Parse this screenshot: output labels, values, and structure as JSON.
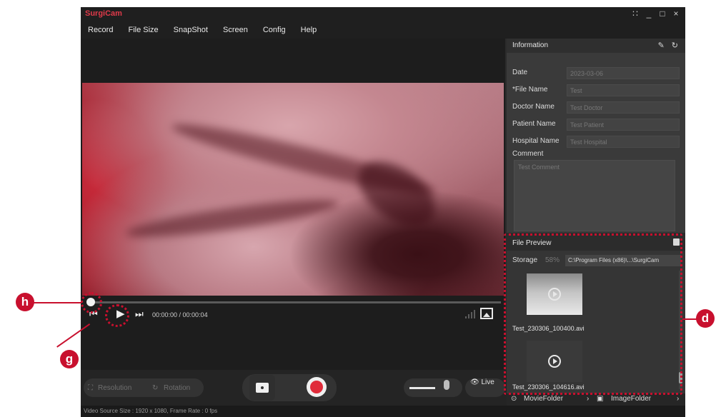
{
  "window": {
    "title": "SurgiCam",
    "controls": {
      "grid": "∷",
      "minimize": "_",
      "maximize": "□",
      "close": "×"
    }
  },
  "menu": [
    "Record",
    "File Size",
    "SnapShot",
    "Screen",
    "Config",
    "Help"
  ],
  "player": {
    "time": "00:00:00  /  00:00:04",
    "icons": [
      "skip-back-icon",
      "play-icon",
      "skip-forward-icon",
      "signal-icon",
      "picture-in-picture-icon"
    ],
    "seek_position": 0
  },
  "information": {
    "title": "Information",
    "fields": [
      {
        "label": "Date",
        "value": "2023-03-06"
      },
      {
        "label": "*File Name",
        "value": "Test"
      },
      {
        "label": "Doctor Name",
        "value": "Test Doctor"
      },
      {
        "label": "Patient Name",
        "value": "Test Patient"
      },
      {
        "label": "Hospital Name",
        "value": "Test Hospital"
      }
    ],
    "comment_label": "Comment",
    "comment_value": "Test Comment"
  },
  "file_preview": {
    "title": "File Preview",
    "storage_label": "Storage",
    "storage_percent": "58%",
    "storage_path": "C:\\Program Files (x86)\\...\\SurgiCam",
    "files": [
      "Test_230306_100400.avi",
      "Test_230306_104616.avi"
    ]
  },
  "folders": {
    "movie": "MovieFolder",
    "image": "ImageFolder"
  },
  "toolbar": {
    "resolution": "Resolution",
    "rotation": "Rotation",
    "live": "Live"
  },
  "status": {
    "text": "Video Source Size : 1920 x 1080, Frame Rate : 0 fps"
  },
  "callouts": {
    "h": "h",
    "g": "g",
    "d": "d"
  },
  "colors": {
    "accent": "#c8102e",
    "record": "#e02b3a"
  }
}
